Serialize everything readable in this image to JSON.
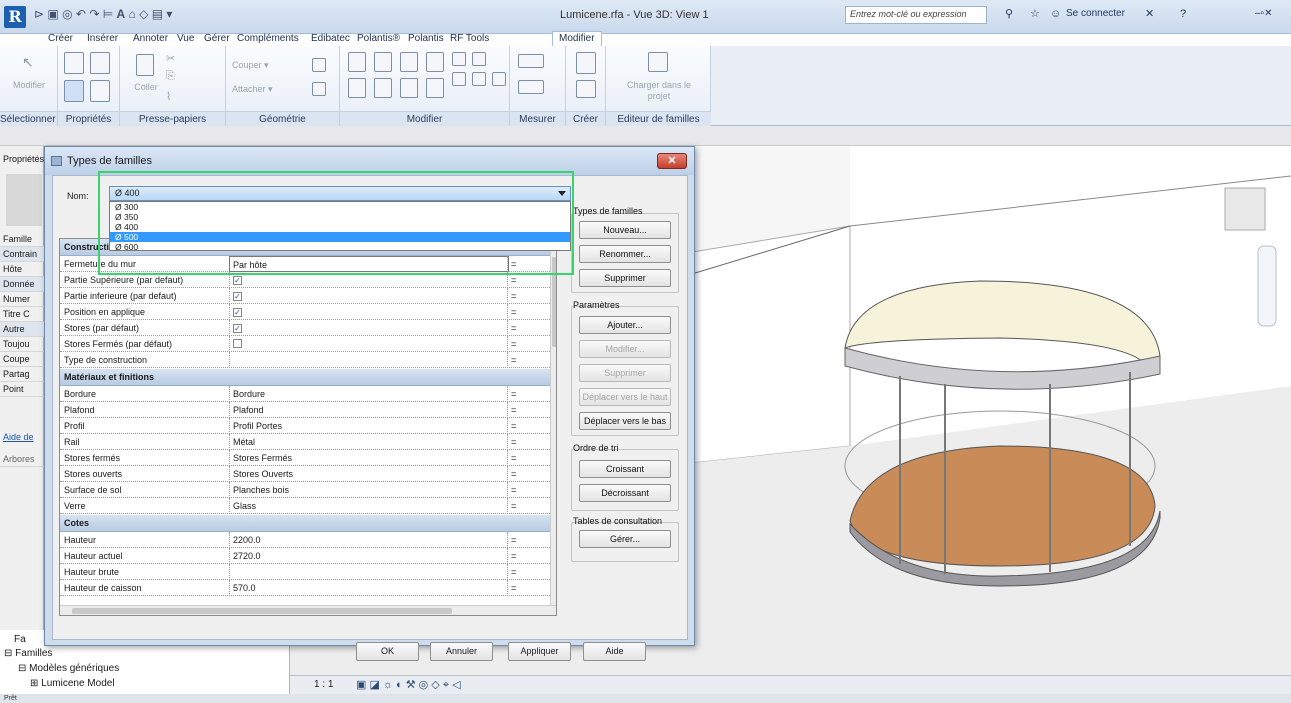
{
  "title_bar": {
    "window_title": "Lumicene.rfa - Vue 3D: View 1",
    "search_placeholder": "Entrez mot-clé ou expression",
    "signin_label": "Se connecter",
    "app_letter": "R"
  },
  "ribbon": {
    "tabs": [
      "Créer",
      "Insérer",
      "Annoter",
      "Vue",
      "Gérer",
      "Compléments",
      "Edibatec",
      "Polantis®",
      "Polantis",
      "RF Tools",
      "Modifier"
    ],
    "active_tab": "Modifier",
    "groups": [
      "Sélectionner ▾",
      "Propriétés",
      "Presse-papiers",
      "Géométrie",
      "Modifier",
      "Mesurer",
      "Créer",
      "Editeur de familles"
    ],
    "labels": {
      "modifier": "Modifier",
      "coller": "Coller",
      "couper": "Couper",
      "attacher": "Attacher",
      "charger": "Charger dans le projet"
    }
  },
  "properties_panel": {
    "header": "Propriétés",
    "items": [
      "Famille",
      "Contrain",
      "Hôte",
      "Donnée",
      "Numer",
      "Titre C",
      "Autre",
      "Toujou",
      "Coupe",
      "Partag",
      "Point"
    ],
    "help_link": "Aide de",
    "browser_label": "Arbores"
  },
  "browser": {
    "items": [
      "Familles",
      "Modèles génériques",
      "Lumicene Model"
    ],
    "f_label": "Fa"
  },
  "view_control": {
    "scale": "1 : 1"
  },
  "statusbar": {
    "text": "Prêt"
  },
  "dialog": {
    "title": "Types de familles",
    "nom_label": "Nom:",
    "nom_value": "Ø 400",
    "options": [
      "Ø 300",
      "Ø 350",
      "Ø 400",
      "Ø 500",
      "Ø 600"
    ],
    "selected_option": "Ø 500",
    "sections": [
      {
        "name": "Construction",
        "rows": [
          {
            "param": "Fermeture du mur",
            "value": "Par hôte",
            "check": null
          },
          {
            "param": "Partie Supérieure (par defaut)",
            "value": "",
            "check": true
          },
          {
            "param": "Partie inferieure (par defaut)",
            "value": "",
            "check": true
          },
          {
            "param": "Position en applique",
            "value": "",
            "check": true
          },
          {
            "param": "Stores (par défaut)",
            "value": "",
            "check": true
          },
          {
            "param": "Stores Fermés (par défaut)",
            "value": "",
            "check": false
          },
          {
            "param": "Type de construction",
            "value": "",
            "check": null
          }
        ]
      },
      {
        "name": "Matériaux et finitions",
        "rows": [
          {
            "param": "Bordure",
            "value": "Bordure",
            "check": null
          },
          {
            "param": "Plafond",
            "value": "Plafond",
            "check": null
          },
          {
            "param": "Profil",
            "value": "Profil Portes",
            "check": null
          },
          {
            "param": "Rail",
            "value": "Métal",
            "check": null
          },
          {
            "param": "Stores fermés",
            "value": "Stores Fermés",
            "check": null
          },
          {
            "param": "Stores ouverts",
            "value": "Stores Ouverts",
            "check": null
          },
          {
            "param": "Surface de sol",
            "value": "Planches bois",
            "check": null
          },
          {
            "param": "Verre",
            "value": "Glass",
            "check": null
          }
        ]
      },
      {
        "name": "Cotes",
        "rows": [
          {
            "param": "Hauteur",
            "value": "2200.0",
            "check": null
          },
          {
            "param": "Hauteur actuel",
            "value": "2720.0",
            "check": null
          },
          {
            "param": "Hauteur brute",
            "value": "",
            "check": null
          },
          {
            "param": "Hauteur de caisson",
            "value": "570.0",
            "check": null
          }
        ]
      }
    ],
    "eq_sign": "=",
    "side": {
      "types_head": "Types de familles",
      "types_buttons": [
        {
          "label": "Nouveau...",
          "enabled": true
        },
        {
          "label": "Renommer...",
          "enabled": true
        },
        {
          "label": "Supprimer",
          "enabled": true
        }
      ],
      "params_head": "Paramètres",
      "params_buttons": [
        {
          "label": "Ajouter...",
          "enabled": true
        },
        {
          "label": "Modifier...",
          "enabled": false
        },
        {
          "label": "Supprimer",
          "enabled": false
        },
        {
          "label": "Déplacer vers le haut",
          "enabled": false
        },
        {
          "label": "Déplacer vers le bas",
          "enabled": true
        }
      ],
      "sort_head": "Ordre de tri",
      "sort_buttons": [
        {
          "label": "Croissant",
          "enabled": true
        },
        {
          "label": "Décroissant",
          "enabled": true
        }
      ],
      "lookup_head": "Tables de consultation",
      "lookup_buttons": [
        {
          "label": "Gérer...",
          "enabled": true
        }
      ]
    },
    "footer": {
      "ok": "OK",
      "cancel": "Annuler",
      "apply": "Appliquer",
      "help": "Aide"
    }
  },
  "colors": {
    "highlight": "#3ad46f",
    "selection": "#3399ff",
    "floor": "#c98b57",
    "ceiling": "#f6f3da"
  }
}
